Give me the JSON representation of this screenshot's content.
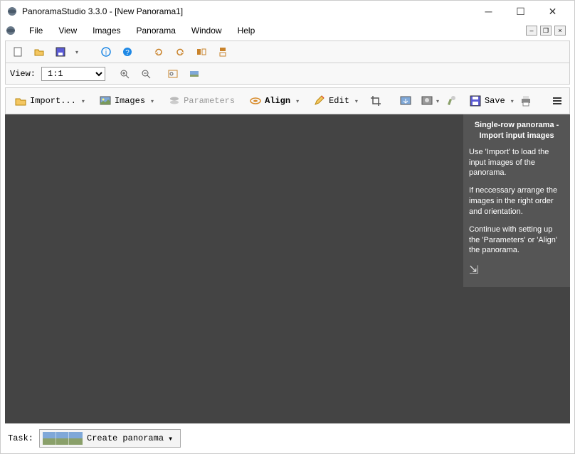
{
  "window": {
    "title": "PanoramaStudio 3.3.0 - [New Panorama1]"
  },
  "menu": {
    "file": "File",
    "view": "View",
    "images": "Images",
    "panorama": "Panorama",
    "window": "Window",
    "help": "Help"
  },
  "view_row": {
    "label": "View:",
    "zoom": "1:1"
  },
  "main_toolbar": {
    "import": "Import...",
    "images": "Images",
    "parameters": "Parameters",
    "align": "Align",
    "edit": "Edit",
    "save": "Save"
  },
  "hint": {
    "title": "Single-row panorama - Import input images",
    "p1": "Use 'Import' to load the input images of the panorama.",
    "p2": "If neccessary arrange the images in the right order and orientation.",
    "p3": "Continue with setting up the 'Parameters' or 'Align' the panorama."
  },
  "taskbar": {
    "label": "Task:",
    "button": "Create panorama"
  }
}
